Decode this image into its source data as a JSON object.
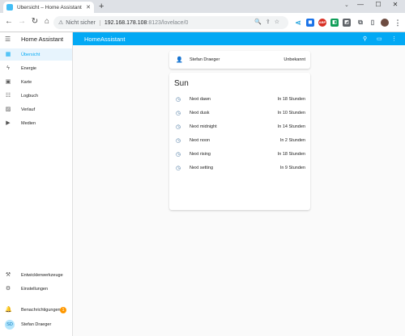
{
  "browser": {
    "tab_title": "Übersicht – Home Assistant",
    "new_tab_icon": "+",
    "url_warning": "Nicht sicher",
    "url_host": "192.168.178.108",
    "url_path": ":8123/lovelace/0",
    "ext_labels": [
      "",
      "",
      "ABP",
      "",
      ""
    ]
  },
  "sidebar": {
    "title": "Home Assistant",
    "items": [
      {
        "label": "Übersicht",
        "icon": "dashboard-icon",
        "active": true
      },
      {
        "label": "Energie",
        "icon": "lightning-icon"
      },
      {
        "label": "Karte",
        "icon": "map-icon"
      },
      {
        "label": "Logbuch",
        "icon": "logbook-icon"
      },
      {
        "label": "Verlauf",
        "icon": "history-icon"
      },
      {
        "label": "Medien",
        "icon": "media-icon"
      }
    ],
    "bottom_items": [
      {
        "label": "Entwicklerwerkzeuge",
        "icon": "hammer-icon"
      },
      {
        "label": "Einstellungen",
        "icon": "gear-icon"
      }
    ],
    "notifications": {
      "label": "Benachrichtigungen",
      "count": "1"
    },
    "user": {
      "initials": "SD",
      "name": "Stefan Draeger"
    }
  },
  "topbar": {
    "title": "HomeAssistant"
  },
  "person_card": {
    "name": "Stefan Draeger",
    "state": "Unbekannt"
  },
  "sun_card": {
    "title": "Sun",
    "rows": [
      {
        "name": "Next dawn",
        "value": "In 18 Stunden"
      },
      {
        "name": "Next dusk",
        "value": "In 10 Stunden"
      },
      {
        "name": "Next midnight",
        "value": "In 14 Stunden"
      },
      {
        "name": "Next noon",
        "value": "In 2 Stunden"
      },
      {
        "name": "Next rising",
        "value": "In 18 Stunden"
      },
      {
        "name": "Next setting",
        "value": "In 9 Stunden"
      }
    ]
  },
  "colors": {
    "accent": "#03a9f4",
    "icon": "#44739e",
    "badge": "#ff9800"
  }
}
